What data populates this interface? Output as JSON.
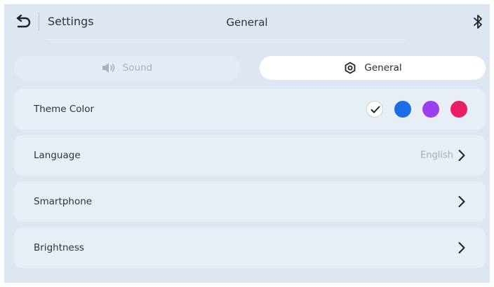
{
  "header": {
    "back_icon": "back-arrow-icon",
    "section": "Settings",
    "title": "General",
    "bluetooth_icon": "bluetooth-icon"
  },
  "tabs": [
    {
      "label": "Sound",
      "icon": "speaker-icon",
      "active": false
    },
    {
      "label": "General",
      "icon": "gear-icon",
      "active": true
    }
  ],
  "rows": {
    "theme": {
      "label": "Theme Color",
      "swatches": [
        {
          "color": "#ffffff",
          "selected": true
        },
        {
          "color": "#1a6fe8",
          "selected": false
        },
        {
          "color": "#9b3ff0",
          "selected": false
        },
        {
          "color": "#ea1f63",
          "selected": false
        }
      ]
    },
    "language": {
      "label": "Language",
      "value": "English"
    },
    "smartphone": {
      "label": "Smartphone"
    },
    "brightness": {
      "label": "Brightness"
    }
  },
  "colors": {
    "background": "#dde6f1",
    "row": "#e8eef6",
    "active_tab": "#ffffff"
  }
}
